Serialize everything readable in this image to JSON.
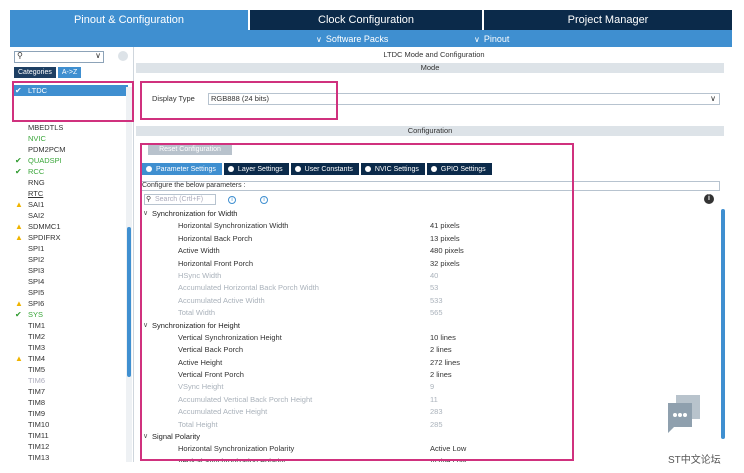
{
  "tabs": {
    "pinout": "Pinout & Configuration",
    "clock": "Clock Configuration",
    "project": "Project Manager"
  },
  "subbar": {
    "software_packs": "Software Packs",
    "pinout": "Pinout"
  },
  "left": {
    "cat_categories": "Categories",
    "cat_az": "A->Z",
    "items": [
      {
        "label": "LTDC",
        "state": "selected-ok"
      },
      {
        "label": "MBEDTLS",
        "state": "normal"
      },
      {
        "label": "NVIC",
        "state": "green"
      },
      {
        "label": "PDM2PCM",
        "state": "normal"
      },
      {
        "label": "QUADSPI",
        "state": "ok"
      },
      {
        "label": "RCC",
        "state": "ok"
      },
      {
        "label": "RNG",
        "state": "normal"
      },
      {
        "label": "RTC",
        "state": "underline"
      },
      {
        "label": "SAI1",
        "state": "warn"
      },
      {
        "label": "SAI2",
        "state": "normal"
      },
      {
        "label": "SDMMC1",
        "state": "warn"
      },
      {
        "label": "SPDIFRX",
        "state": "warn"
      },
      {
        "label": "SPI1",
        "state": "normal"
      },
      {
        "label": "SPI2",
        "state": "normal"
      },
      {
        "label": "SPI3",
        "state": "normal"
      },
      {
        "label": "SPI4",
        "state": "normal"
      },
      {
        "label": "SPI5",
        "state": "normal"
      },
      {
        "label": "SPI6",
        "state": "warn"
      },
      {
        "label": "SYS",
        "state": "ok-green"
      },
      {
        "label": "TIM1",
        "state": "normal"
      },
      {
        "label": "TIM2",
        "state": "normal"
      },
      {
        "label": "TIM3",
        "state": "normal"
      },
      {
        "label": "TIM4",
        "state": "warn"
      },
      {
        "label": "TIM5",
        "state": "normal"
      },
      {
        "label": "TIM6",
        "state": "gray"
      },
      {
        "label": "TIM7",
        "state": "normal"
      },
      {
        "label": "TIM8",
        "state": "normal"
      },
      {
        "label": "TIM9",
        "state": "normal"
      },
      {
        "label": "TIM10",
        "state": "normal"
      },
      {
        "label": "TIM11",
        "state": "normal"
      },
      {
        "label": "TIM12",
        "state": "normal"
      },
      {
        "label": "TIM13",
        "state": "normal"
      }
    ]
  },
  "main": {
    "title": "LTDC Mode and Configuration",
    "mode_bar": "Mode",
    "display_type_label": "Display Type",
    "display_type_value": "RGB888 (24 bits)",
    "config_bar": "Configuration",
    "reset_button": "Reset Configuration",
    "config_tabs": [
      "Parameter Settings",
      "Layer Settings",
      "User Constants",
      "NVIC Settings",
      "GPIO Settings"
    ],
    "config_desc": "Configure the below parameters :",
    "search_placeholder": "Search (Crtl+F)",
    "params": [
      {
        "name": "Synchronization for Width",
        "value": "",
        "kind": "group"
      },
      {
        "name": "Horizontal Synchronization Width",
        "value": "41 pixels",
        "kind": "param"
      },
      {
        "name": "Horizontal Back Porch",
        "value": "13 pixels",
        "kind": "param"
      },
      {
        "name": "Active Width",
        "value": "480 pixels",
        "kind": "param"
      },
      {
        "name": "Horizontal Front Porch",
        "value": "32 pixels",
        "kind": "param"
      },
      {
        "name": "HSync Width",
        "value": "40",
        "kind": "dim"
      },
      {
        "name": "Accumulated Horizontal Back Porch Width",
        "value": "53",
        "kind": "dim"
      },
      {
        "name": "Accumulated Active Width",
        "value": "533",
        "kind": "dim"
      },
      {
        "name": "Total Width",
        "value": "565",
        "kind": "dim"
      },
      {
        "name": "Synchronization for Height",
        "value": "",
        "kind": "group"
      },
      {
        "name": "Vertical Synchronization Height",
        "value": "10 lines",
        "kind": "param"
      },
      {
        "name": "Vertical Back Porch",
        "value": "2 lines",
        "kind": "param"
      },
      {
        "name": "Active Height",
        "value": "272 lines",
        "kind": "param"
      },
      {
        "name": "Vertical Front Porch",
        "value": "2 lines",
        "kind": "param"
      },
      {
        "name": "VSync Height",
        "value": "9",
        "kind": "dim"
      },
      {
        "name": "Accumulated Vertical Back Porch Height",
        "value": "11",
        "kind": "dim"
      },
      {
        "name": "Accumulated Active Height",
        "value": "283",
        "kind": "dim"
      },
      {
        "name": "Total Height",
        "value": "285",
        "kind": "dim"
      },
      {
        "name": "Signal Polarity",
        "value": "",
        "kind": "group"
      },
      {
        "name": "Horizontal Synchronization Polarity",
        "value": "Active Low",
        "kind": "param"
      },
      {
        "name": "Vertical Synchronization Polarity",
        "value": "Active Low",
        "kind": "param"
      }
    ]
  },
  "watermark": "ST中文论坛",
  "colors": {
    "accent": "#3f8fd0",
    "dark_tab": "#0b2a4a",
    "highlight": "#d0317e"
  }
}
